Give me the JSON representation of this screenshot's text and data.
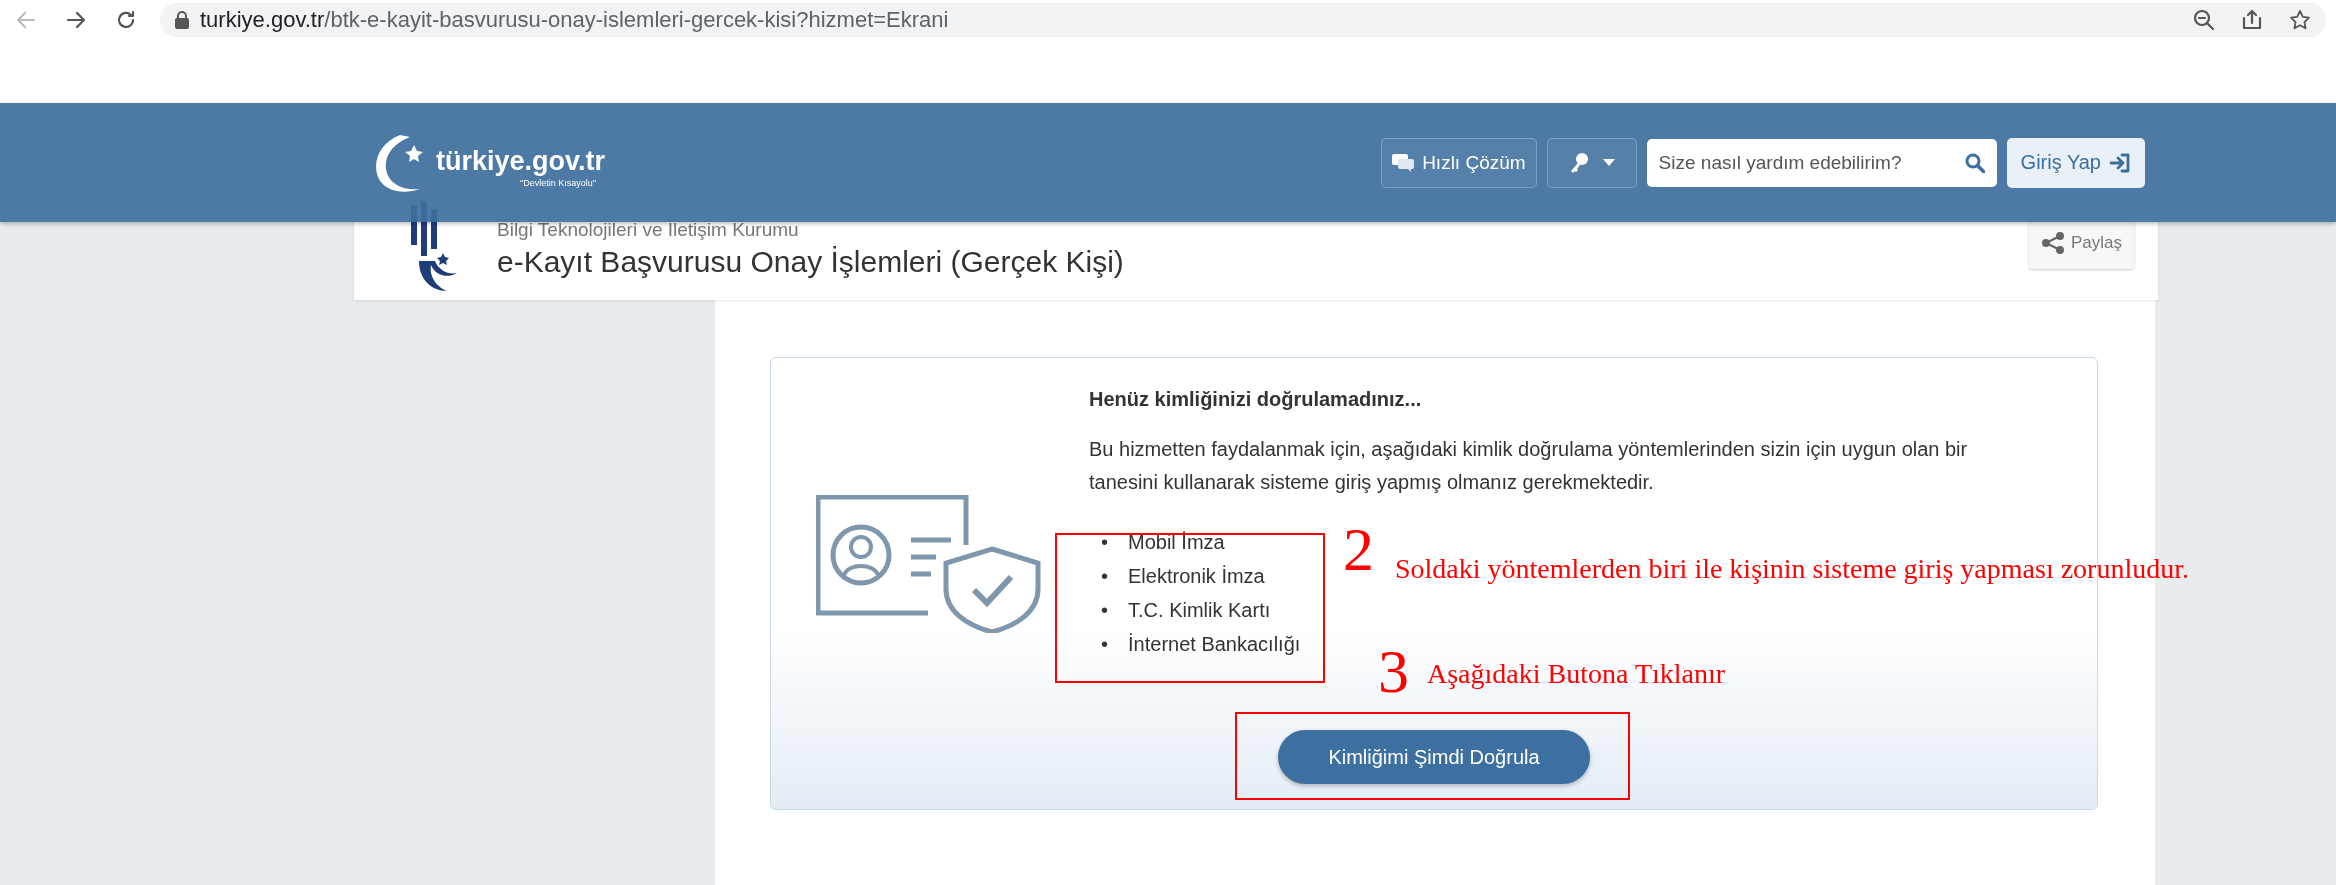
{
  "browser": {
    "url_host": "turkiye.gov.tr",
    "url_path": "/btk-e-kayit-basvurusu-onay-islemleri-gercek-kisi?hizmet=Ekrani"
  },
  "header": {
    "logo_text": "türkiye.gov.tr",
    "logo_tagline": "\"Devletin Kısayolu\"",
    "quick_solution": "Hızlı Çözüm",
    "search_placeholder": "Size nasıl yardım edebilirim?",
    "login": "Giriş Yap"
  },
  "page": {
    "institution": "Bilgi Teknolojileri ve İletişim Kurumu",
    "title": "e-Kayıt Başvurusu Onay İşlemleri (Gerçek Kişi)",
    "share": "Paylaş"
  },
  "notice": {
    "heading": "Henüz kimliğinizi doğrulamadınız...",
    "paragraph": "Bu hizmetten faydalanmak için, aşağıdaki kimlik doğrulama yöntemlerinden sizin için uygun olan bir tanesini kullanarak sisteme giriş yapmış olmanız gerekmektedir.",
    "methods": [
      {
        "bullet": "•",
        "label": "Mobil İmza"
      },
      {
        "bullet": "•",
        "label": "Elektronik İmza"
      },
      {
        "bullet": "•",
        "label": "T.C. Kimlik Kartı"
      },
      {
        "bullet": "•",
        "label": "İnternet Bankacılığı"
      }
    ],
    "button": "Kimliğimi Şimdi Doğrula"
  },
  "annotations": [
    {
      "number": "2",
      "text": "Soldaki yöntemlerden biri ile kişinin sisteme giriş yapması zorunludur."
    },
    {
      "number": "3",
      "text": "Aşağıdaki Butona Tıklanır"
    }
  ]
}
